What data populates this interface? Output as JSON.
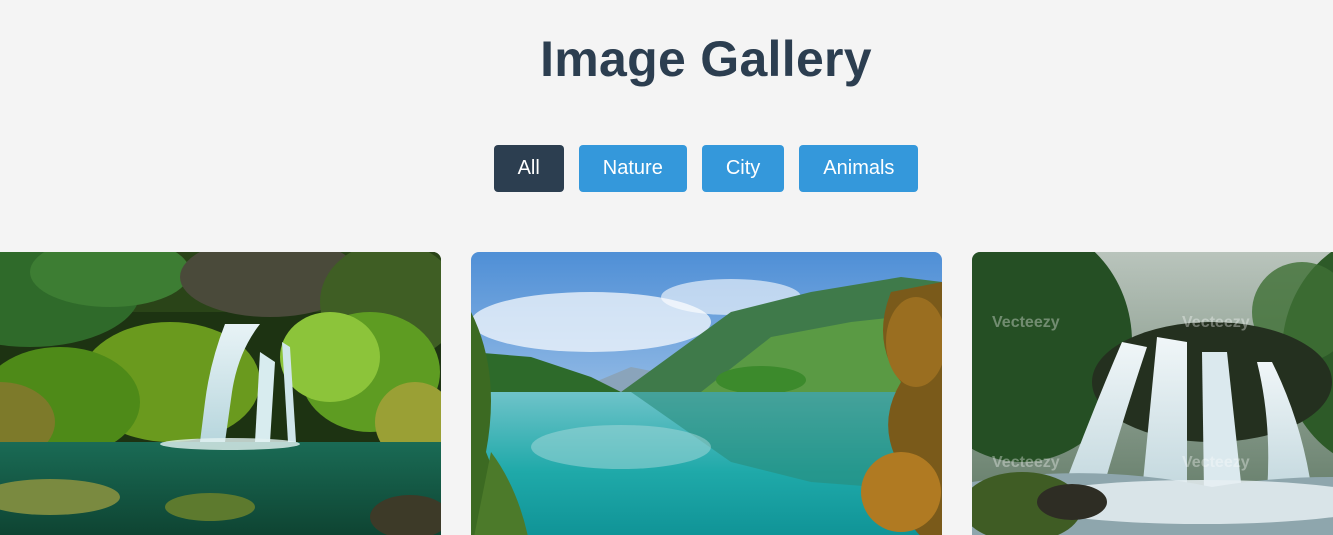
{
  "header": {
    "title": "Image Gallery"
  },
  "filters": {
    "active": "All",
    "items": [
      {
        "label": "All"
      },
      {
        "label": "Nature"
      },
      {
        "label": "City"
      },
      {
        "label": "Animals"
      }
    ]
  },
  "gallery": {
    "images": [
      {
        "subject": "waterfall in mossy forest",
        "category": "Nature"
      },
      {
        "subject": "turquoise mountain lake",
        "category": "Nature"
      },
      {
        "subject": "misty forest waterfall",
        "category": "Nature",
        "watermark": "Vecteezy"
      }
    ]
  },
  "colors": {
    "background": "#f4f4f4",
    "title": "#2c3e50",
    "button": "#3498db",
    "button_active": "#2c3e50"
  }
}
